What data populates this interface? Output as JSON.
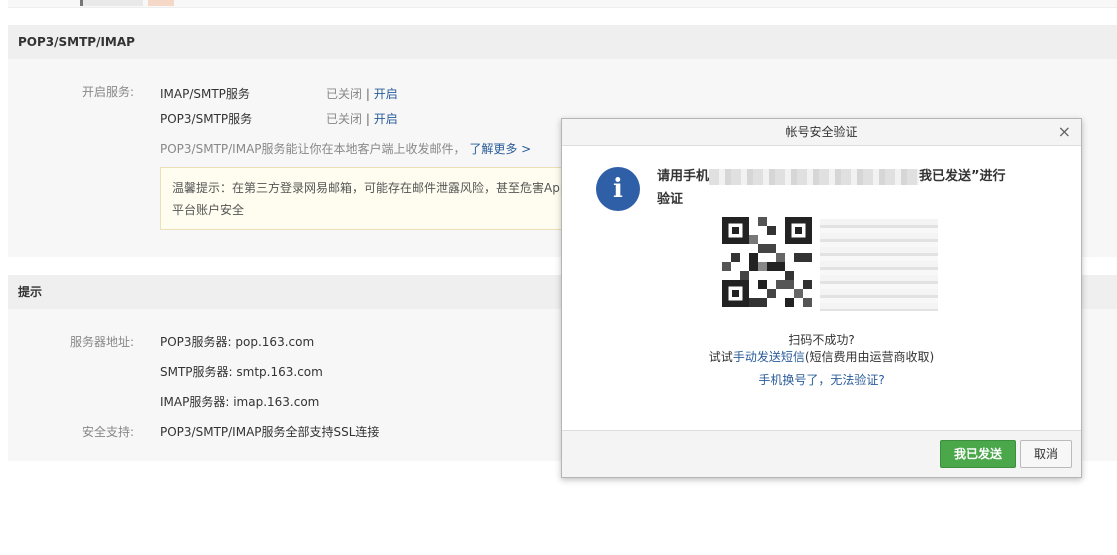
{
  "section_pop": {
    "title": "POP3/SMTP/IMAP",
    "service_label": "开启服务:",
    "services": [
      {
        "name": "IMAP/SMTP服务",
        "status": "已关闭",
        "divider": "|",
        "action": "开启"
      },
      {
        "name": "POP3/SMTP服务",
        "status": "已关闭",
        "divider": "|",
        "action": "开启"
      }
    ],
    "desc": "POP3/SMTP/IMAP服务能让你在本地客户端上收发邮件，",
    "learn_more": "了解更多 >",
    "tip_line1": "温馨提示：在第三方登录网易邮箱，可能存在邮件泄露风险，甚至危害App",
    "tip_line2": "平台账户安全"
  },
  "section_hint": {
    "title": "提示",
    "server_label": "服务器地址:",
    "servers": [
      "POP3服务器: pop.163.com",
      "SMTP服务器: smtp.163.com",
      "IMAP服务器: imap.163.com"
    ],
    "security_label": "安全支持:",
    "security_value": "POP3/SMTP/IMAP服务全部支持SSL连接"
  },
  "dialog": {
    "title": "帐号安全验证",
    "close": "×",
    "info_glyph": "i",
    "msg_prefix": "请用手机",
    "msg_suffix": "我已发送”进行",
    "msg_line2": "验证",
    "scan_fail": "扫码不成功?",
    "manual_prefix": "试试",
    "manual_link": "手动发送短信",
    "manual_suffix": "(短信费用由运营商收取)",
    "phone_changed": "手机换号了，无法验证?",
    "ok_button": "我已发送",
    "cancel_button": "取消"
  },
  "colors": {
    "link": "#2a5c9a",
    "ok_button": "#4aa74a",
    "info_icon": "#2f5fa6"
  }
}
